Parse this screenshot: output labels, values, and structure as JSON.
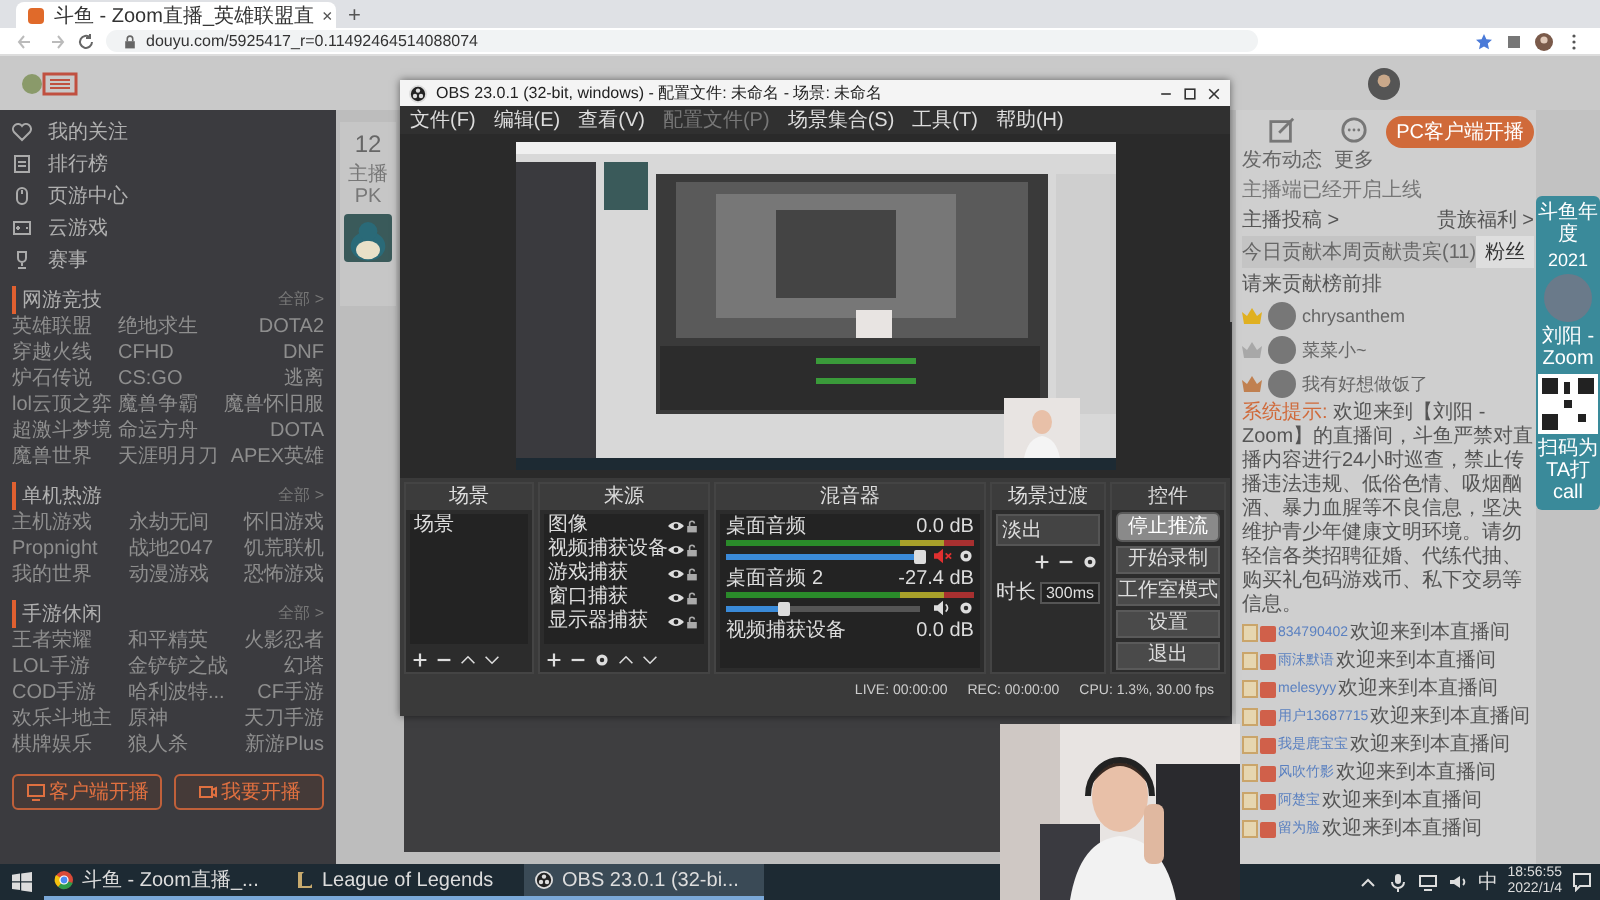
{
  "browser": {
    "tab": {
      "title": "斗鱼 - Zoom直播_英雄联盟直",
      "close": "×"
    },
    "new_tab": "+",
    "url": "douyu.com/5925417_r=0.11492464514088074"
  },
  "sidebar": {
    "nav": [
      {
        "label": "我的关注"
      },
      {
        "label": "排行榜"
      },
      {
        "label": "页游中心"
      },
      {
        "label": "云游戏"
      },
      {
        "label": "赛事"
      }
    ],
    "sections": [
      {
        "title": "网游竞技",
        "more": "全部 >",
        "items": [
          "英雄联盟",
          "绝地求生",
          "DOTA2",
          "穿越火线",
          "CFHD",
          "DNF",
          "炉石传说",
          "CS:GO",
          "逃离",
          "lol云顶之弈",
          "魔兽争霸",
          "魔兽怀旧服",
          "超激斗梦境",
          "命运方舟",
          "DOTA",
          "魔兽世界",
          "天涯明月刀",
          "APEX英雄"
        ]
      },
      {
        "title": "单机热游",
        "more": "全部 >",
        "items": [
          "主机游戏",
          "永劫无间",
          "怀旧游戏",
          "Propnight",
          "战地2047",
          "饥荒联机",
          "我的世界",
          "动漫游戏",
          "恐怖游戏"
        ]
      },
      {
        "title": "手游休闲",
        "more": "全部 >",
        "items": [
          "王者荣耀",
          "和平精英",
          "火影忍者",
          "LOL手游",
          "金铲铲之战",
          "幻塔",
          "COD手游",
          "哈利波特...",
          "CF手游",
          "欢乐斗地主",
          "原神",
          "天刀手游",
          "棋牌娱乐",
          "狼人杀",
          "新游Plus"
        ]
      }
    ],
    "actions": [
      {
        "label": "客户端开播"
      },
      {
        "label": "我要开播"
      }
    ]
  },
  "anchor_card": {
    "count": "12",
    "caption": "主播PK"
  },
  "obs": {
    "title": "OBS 23.0.1 (32-bit, windows) - 配置文件: 未命名 - 场景: 未命名",
    "menu": [
      {
        "label": "文件(F)",
        "disabled": false
      },
      {
        "label": "编辑(E)",
        "disabled": false
      },
      {
        "label": "查看(V)",
        "disabled": false
      },
      {
        "label": "配置文件(P)",
        "disabled": true
      },
      {
        "label": "场景集合(S)",
        "disabled": false
      },
      {
        "label": "工具(T)",
        "disabled": false
      },
      {
        "label": "帮助(H)",
        "disabled": false
      }
    ],
    "scenes": {
      "title": "场景",
      "items": [
        {
          "label": "场景",
          "selected": false
        }
      ]
    },
    "sources": {
      "title": "来源",
      "items": [
        "图像",
        "视频捕获设备",
        "游戏捕获",
        "窗口捕获",
        "显示器捕获"
      ]
    },
    "mixer": {
      "title": "混音器",
      "channels": [
        {
          "name": "桌面音频",
          "reading": "0.0 dB",
          "muted": true,
          "level": 1.0
        },
        {
          "name": "桌面音频 2",
          "reading": "-27.4 dB",
          "muted": false,
          "level": 0.3
        },
        {
          "name": "视频捕获设备",
          "reading": "0.0 dB"
        }
      ]
    },
    "transitions": {
      "title": "场景过渡",
      "type": "淡出",
      "duration_label": "时长",
      "duration": "300ms"
    },
    "controls": {
      "title": "控件",
      "buttons": [
        {
          "label": "停止推流",
          "active": true
        },
        {
          "label": "开始录制",
          "active": false
        },
        {
          "label": "工作室模式",
          "active": false
        },
        {
          "label": "设置",
          "active": false
        },
        {
          "label": "退出",
          "active": false
        }
      ]
    },
    "status": {
      "live": "LIVE: 00:00:00",
      "rec": "REC: 00:00:00",
      "cpu": "CPU: 1.3%, 30.00 fps"
    }
  },
  "chat": {
    "tools": [
      {
        "label": "发布动态"
      },
      {
        "label": "更多"
      }
    ],
    "client_button": "PC客户端开播",
    "client_note": "主播端已经开启上线",
    "links": [
      "主播投稿 >",
      "贵族福利 >"
    ],
    "tabs": [
      {
        "label": "今日贡献",
        "selected": false
      },
      {
        "label": "本周贡献",
        "selected": false
      },
      {
        "label": "贵宾(11)",
        "selected": false
      },
      {
        "label": "粉丝",
        "selected": true
      }
    ],
    "rank_title": "请来贡献榜前排",
    "rank": [
      {
        "name": "chrysanthem",
        "color": "#e0b020"
      },
      {
        "name": "菜菜小~",
        "color": "#a8a8a8"
      },
      {
        "name": "我有好想做饭了",
        "color": "#c08050"
      }
    ],
    "notice": {
      "label": "系统提示:",
      "text": "欢迎来到【刘阳 - Zoom】的直播间，斗鱼严禁对直播内容进行24小时巡查，禁止传播违法违规、低俗色情、吸烟酗酒、暴力血腥等不良信息，坚决维护青少年健康文明环境。请勿轻信各类招聘征婚、代练代抽、购买礼包码游戏币、私下交易等信息。"
    },
    "messages": [
      {
        "user": "834790402",
        "text": "欢迎来到本直播间"
      },
      {
        "user": "雨沫默语",
        "text": "欢迎来到本直播间"
      },
      {
        "user": "melesyyy",
        "text": "欢迎来到本直播间"
      },
      {
        "user": "用户13687715",
        "text": "欢迎来到本直播间"
      },
      {
        "user": "我是鹿宝宝",
        "text": "欢迎来到本直播间"
      },
      {
        "user": "风吹竹影",
        "text": "欢迎来到本直播间"
      },
      {
        "user": "阿楚宝",
        "text": "欢迎来到本直播间"
      },
      {
        "user": "留为脸",
        "text": "欢迎来到本直播间"
      }
    ]
  },
  "ad": {
    "title": "斗鱼年度",
    "year": "2021",
    "name": "刘阳 - Zoom",
    "caption": "扫码为TA打call"
  },
  "taskbar": {
    "items": [
      {
        "label": "斗鱼 - Zoom直播_...",
        "selected": false
      },
      {
        "label": "League of Legends",
        "selected": false
      },
      {
        "label": "OBS 23.0.1 (32-bi...",
        "selected": true
      }
    ],
    "ime": "中",
    "time": "18:56:55",
    "date": "2022/1/4"
  }
}
